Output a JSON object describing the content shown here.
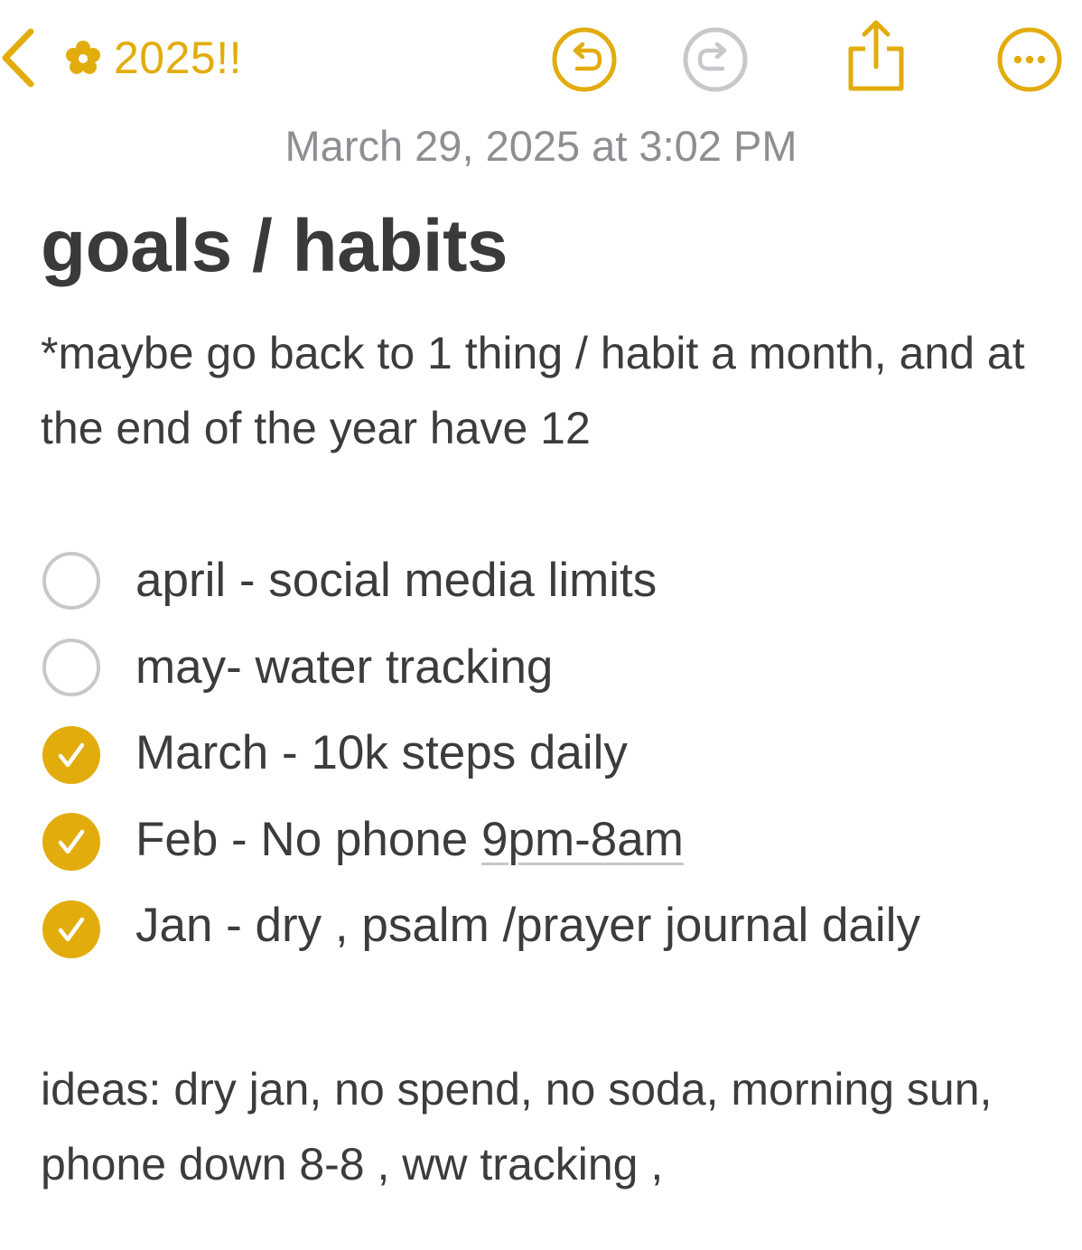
{
  "toolbar": {
    "back_label": "2025!!",
    "icons": {
      "back": "chevron-left-icon",
      "folder": "flower-icon",
      "undo": "undo-icon",
      "redo": "redo-icon",
      "share": "share-icon",
      "more": "ellipsis-icon"
    },
    "redo_enabled": false
  },
  "note": {
    "timestamp": "March 29, 2025 at 3:02 PM",
    "title": "goals / habits",
    "intro": "*maybe go back to 1 thing / habit a month, and at the end of the year have 12",
    "checklist": [
      {
        "text": "april - social media limits",
        "checked": false
      },
      {
        "text": "may- water tracking",
        "checked": false
      },
      {
        "text": "March -  10k steps daily",
        "checked": true
      },
      {
        "text_prefix": "Feb - No phone ",
        "text_link": "9pm-8am",
        "checked": true
      },
      {
        "text": "Jan - dry , psalm /prayer journal daily",
        "checked": true
      }
    ],
    "ideas": "ideas: dry jan, no spend, no soda, morning sun, phone down 8-8 , ww tracking ,"
  },
  "colors": {
    "accent": "#e2ac0c",
    "disabled": "#c7c7cc",
    "text": "#3c3c3c",
    "secondary": "#8e8e93",
    "unchecked_border": "#c8c8c8"
  }
}
